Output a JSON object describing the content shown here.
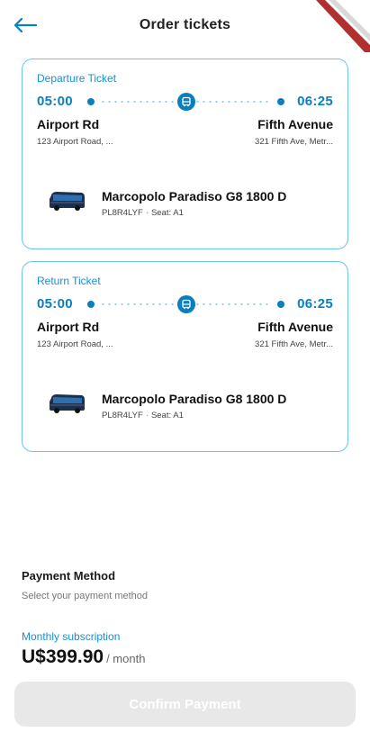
{
  "header": {
    "title": "Order tickets"
  },
  "tickets": [
    {
      "label": "Departure Ticket",
      "departure_time": "05:00",
      "arrival_time": "06:25",
      "from_station": "Airport Rd",
      "to_station": "Fifth Avenue",
      "from_address": "123 Airport Road, ...",
      "to_address": "321 Fifth Ave, Metr...",
      "bus_name": "Marcopolo Paradiso G8 1800 D",
      "plate": "PL8R4LYF",
      "seat": "Seat: A1"
    },
    {
      "label": "Return Ticket",
      "departure_time": "05:00",
      "arrival_time": "06:25",
      "from_station": "Airport Rd",
      "to_station": "Fifth Avenue",
      "from_address": "123 Airport Road, ...",
      "to_address": "321 Fifth Ave, Metr...",
      "bus_name": "Marcopolo Paradiso G8 1800 D",
      "plate": "PL8R4LYF",
      "seat": "Seat: A1"
    }
  ],
  "payment": {
    "title": "Payment Method",
    "subtitle": "Select your payment method",
    "plan_label": "Monthly subscription",
    "price": "U$399.90",
    "period": "/ month",
    "confirm_label": "Confirm Payment"
  },
  "colors": {
    "accent": "#0a7fbf",
    "card_border": "#6cc3ef",
    "button_disabled": "#e8e8e8",
    "ribbon": "#b03030"
  }
}
